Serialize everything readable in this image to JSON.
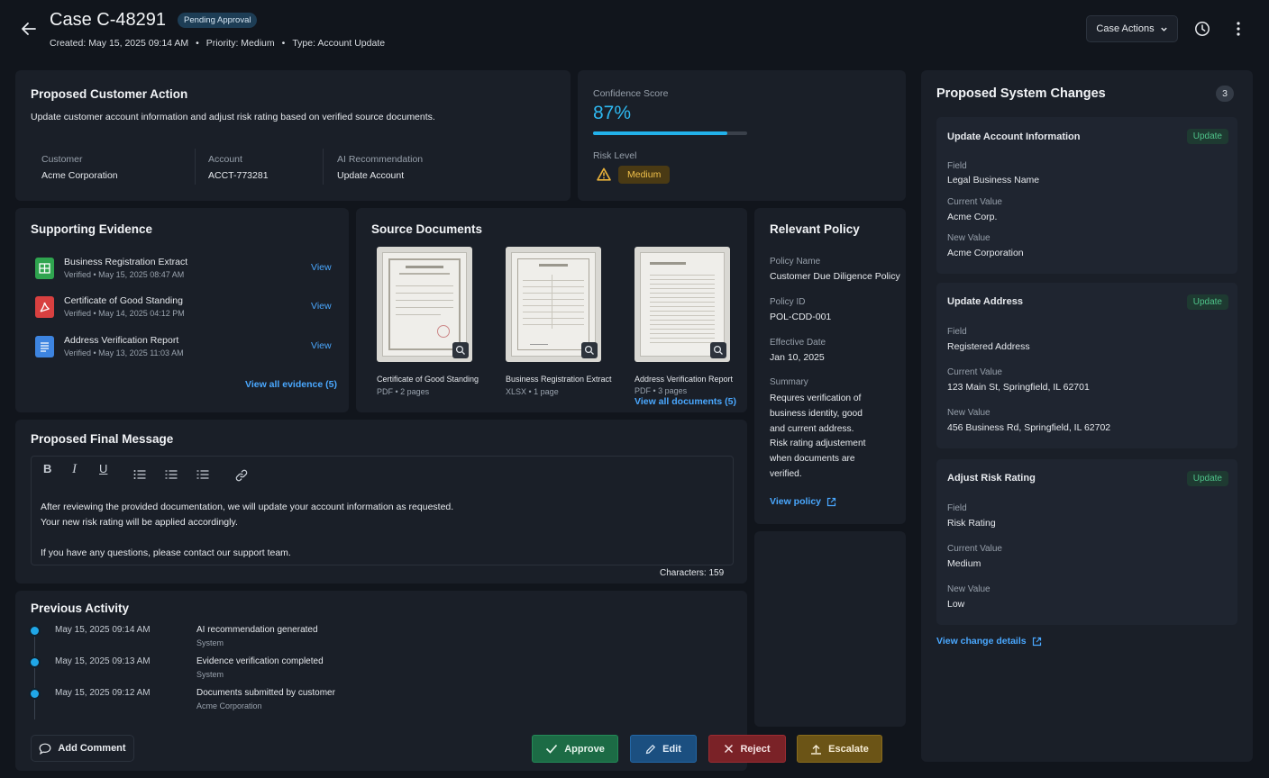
{
  "header": {
    "title": "Case C-48291",
    "status": "Pending Approval",
    "created": "Created: May 15, 2025 09:14 AM",
    "priority": "Priority: Medium",
    "type": "Type: Account Update",
    "actions_label": "Case Actions"
  },
  "proposed_action": {
    "title": "Proposed Customer Action",
    "description": "Update customer account information and adjust risk rating based on verified source documents.",
    "customer_label": "Customer",
    "customer_value": "Acme Corporation",
    "account_label": "Account",
    "account_value": "ACCT-773281",
    "ai_label": "AI Recommendation",
    "ai_value": "Update Account"
  },
  "confidence": {
    "label": "Confidence Score",
    "value": "87%",
    "fraction": 0.87,
    "risk_label": "Risk Level",
    "risk_value": "Medium"
  },
  "evidence": {
    "title": "Supporting Evidence",
    "items": [
      {
        "name": "Business Registration Extract",
        "meta": "Verified • May 15, 2025 08:47 AM",
        "action": "View",
        "color": "#2fa44f"
      },
      {
        "name": "Certificate of Good Standing",
        "meta": "Verified • May 14, 2025 04:12 PM",
        "action": "View",
        "color": "#d84040"
      },
      {
        "name": "Address Verification Report",
        "meta": "Verified • May 13, 2025 11:03 AM",
        "action": "View",
        "color": "#3d84e0"
      }
    ],
    "view_all": "View all evidence (5)"
  },
  "documents": {
    "title": "Source Documents",
    "items": [
      {
        "name": "Certificate of Good Standing",
        "meta": "PDF • 2 pages"
      },
      {
        "name": "Business Registration Extract",
        "meta": "XLSX • 1 page"
      },
      {
        "name": "Address Verification Report",
        "meta": "PDF • 3 pages"
      }
    ],
    "view_all": "View all documents (5)"
  },
  "policy": {
    "title": "Relevant Policy",
    "name_label": "Policy Name",
    "name_value": "Customer Due Diligence Policy",
    "id_label": "Policy ID",
    "id_value": "POL-CDD-001",
    "date_label": "Effective Date",
    "date_value": "Jan 10, 2025",
    "summary_label": "Summary",
    "summary_lines": [
      "Requres verification of",
      "business identity, good",
      "and current address.",
      "Risk rating adjustement",
      "when documents are",
      "verified."
    ],
    "view_policy": "View policy"
  },
  "message": {
    "title": "Proposed Final Message",
    "line1": "After reviewing the provided documentation, we will update your account information as requested.",
    "line2": "Your new risk rating will be applied accordingly.",
    "line3": "If you have any questions, please contact our support team.",
    "characters": "Characters: 159"
  },
  "activity": {
    "title": "Previous Activity",
    "items": [
      {
        "time": "May 15, 2025 09:14 AM",
        "event": "AI recommendation generated",
        "actor": "System"
      },
      {
        "time": "May 15, 2025 09:13 AM",
        "event": "Evidence verification completed",
        "actor": "System"
      },
      {
        "time": "May 15, 2025 09:12 AM",
        "event": "Documents submitted by customer",
        "actor": "Acme Corporation"
      }
    ],
    "add_comment": "Add Comment"
  },
  "actions": {
    "approve": "Approve",
    "edit": "Edit",
    "reject": "Reject",
    "escalate": "Escalate"
  },
  "changes": {
    "title": "Proposed System Changes",
    "count": "3",
    "field_label": "Field",
    "current_label": "Current Value",
    "new_label": "New Value",
    "items": [
      {
        "title": "Update Account Information",
        "badge": "Update",
        "field": "Legal Business Name",
        "current": "Acme Corp.",
        "new": "Acme Corporation"
      },
      {
        "title": "Update Address",
        "badge": "Update",
        "field": "Registered Address",
        "current": "123 Main St, Springfield, IL 62701",
        "new": "456 Business Rd, Springfield, IL 62702"
      },
      {
        "title": "Adjust Risk Rating",
        "badge": "Update",
        "field": "Risk Rating",
        "current": "Medium",
        "new": "Low"
      }
    ],
    "view_details": "View change details"
  }
}
